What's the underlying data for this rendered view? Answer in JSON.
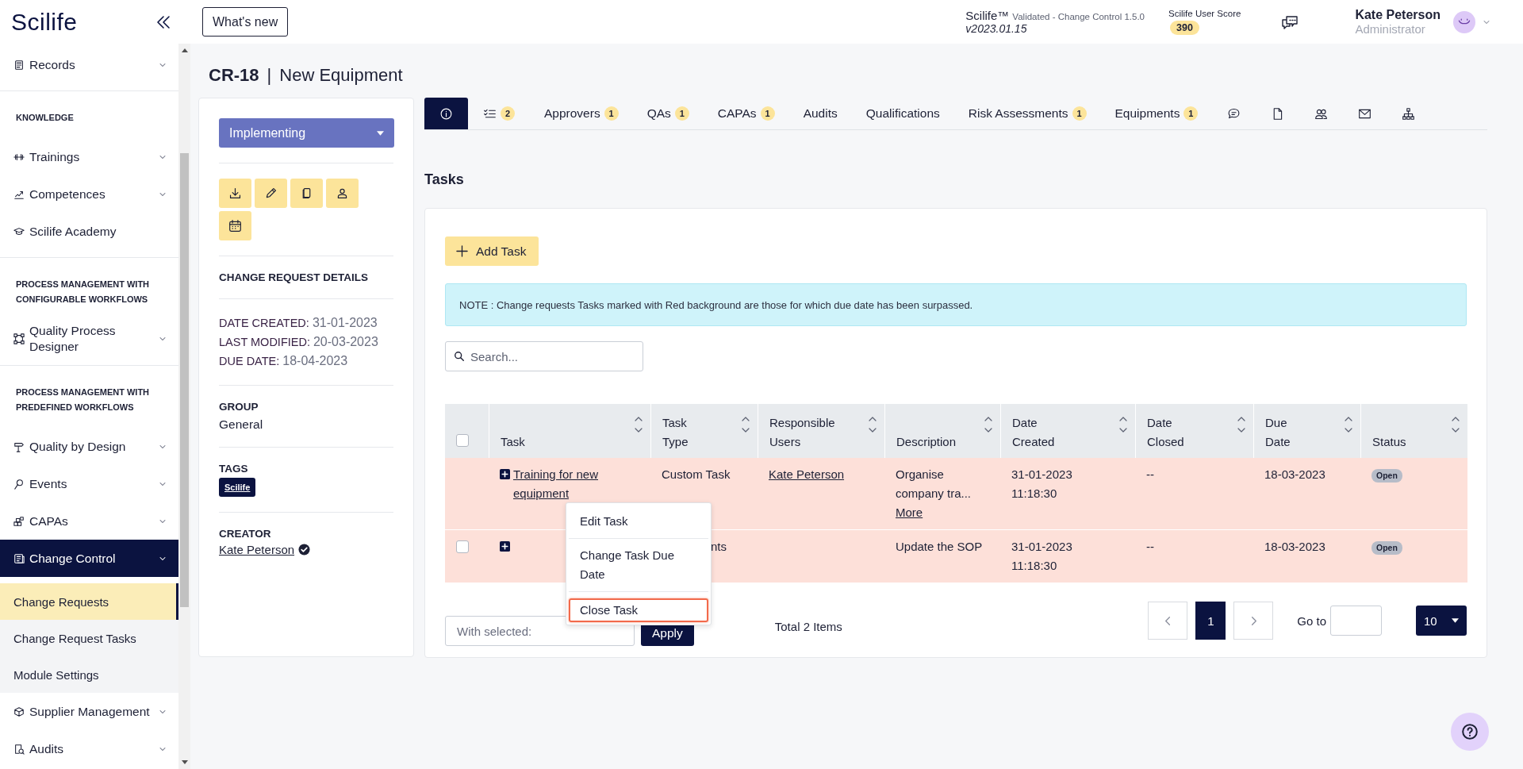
{
  "sidebar": {
    "logo": "Scilife",
    "items": [
      {
        "kind": "item",
        "label": "Records",
        "expandable": true,
        "selected": false
      },
      {
        "kind": "section",
        "label": "KNOWLEDGE"
      },
      {
        "kind": "item",
        "label": "Trainings",
        "expandable": true,
        "selected": false
      },
      {
        "kind": "item",
        "label": "Competences",
        "expandable": true,
        "selected": false
      },
      {
        "kind": "item",
        "label": "Scilife Academy",
        "expandable": false,
        "selected": false
      },
      {
        "kind": "section",
        "label": "PROCESS MANAGEMENT WITH CONFIGURABLE WORKFLOWS"
      },
      {
        "kind": "item",
        "label": "Quality Process Designer",
        "expandable": true,
        "selected": false
      },
      {
        "kind": "section",
        "label": "PROCESS MANAGEMENT WITH PREDEFINED WORKFLOWS"
      },
      {
        "kind": "item",
        "label": "Quality by Design",
        "expandable": true,
        "selected": false
      },
      {
        "kind": "item",
        "label": "Events",
        "expandable": true,
        "selected": false
      },
      {
        "kind": "item",
        "label": "CAPAs",
        "expandable": true,
        "selected": false
      },
      {
        "kind": "item",
        "label": "Change Control",
        "expandable": true,
        "selected": true,
        "children": [
          {
            "label": "Change Requests",
            "selected": true
          },
          {
            "label": "Change Request Tasks",
            "selected": false
          },
          {
            "label": "Module Settings",
            "selected": false
          }
        ]
      },
      {
        "kind": "item",
        "label": "Supplier Management",
        "expandable": true,
        "selected": false
      },
      {
        "kind": "item",
        "label": "Audits",
        "expandable": true,
        "selected": false
      }
    ]
  },
  "topbar": {
    "whats_new": "What's new",
    "product": "Scilife™",
    "edition": "Validated - Change Control 1.5.0",
    "version": "v2023.01.15",
    "score_label": "Scilife User Score",
    "score": "390",
    "user_name": "Kate Peterson",
    "user_role": "Administrator"
  },
  "page_title": {
    "code": "CR-18",
    "separator": "|",
    "name": "New Equipment"
  },
  "details": {
    "status": "Implementing",
    "section_title": "CHANGE REQUEST DETAILS",
    "fields": [
      {
        "label": "DATE CREATED:",
        "value": "31-01-2023"
      },
      {
        "label": "LAST MODIFIED:",
        "value": "20-03-2023"
      },
      {
        "label": "DUE DATE:",
        "value": "18-04-2023"
      }
    ],
    "group_label": "GROUP",
    "group": "General",
    "tags_label": "TAGS",
    "tags": [
      "Scilife"
    ],
    "creator_label": "CREATOR",
    "creator": "Kate Peterson",
    "creator_verified": true
  },
  "tabs": [
    {
      "kind": "icon",
      "selected": true
    },
    {
      "kind": "icon",
      "badge": "2",
      "selected": false
    },
    {
      "kind": "text",
      "label": "Approvers",
      "badge": "1",
      "selected": false
    },
    {
      "kind": "text",
      "label": "QAs",
      "badge": "1",
      "selected": false
    },
    {
      "kind": "text",
      "label": "CAPAs",
      "badge": "1",
      "selected": false
    },
    {
      "kind": "text",
      "label": "Audits",
      "selected": false
    },
    {
      "kind": "text",
      "label": "Qualifications",
      "selected": false
    },
    {
      "kind": "text",
      "label": "Risk Assessments",
      "badge": "1",
      "selected": false
    },
    {
      "kind": "text",
      "label": "Equipments",
      "badge": "1",
      "selected": false
    },
    {
      "kind": "icon",
      "selected": false
    },
    {
      "kind": "icon",
      "selected": false
    },
    {
      "kind": "icon",
      "selected": false
    },
    {
      "kind": "icon",
      "selected": false
    },
    {
      "kind": "icon",
      "selected": false
    }
  ],
  "tasks": {
    "title": "Tasks",
    "add_button": "Add Task",
    "note": "NOTE : Change requests Tasks marked with Red background are those for which due date has been surpassed.",
    "search_placeholder": "Search...",
    "header_checked": false,
    "columns": [
      "Task",
      "Task Type",
      "Responsible Users",
      "Description",
      "Date Created",
      "Date Closed",
      "Due Date",
      "Status"
    ],
    "rows": [
      {
        "overdue": true,
        "task": "Training for new equipment",
        "task_type": "Custom Task",
        "responsible": "Kate Peterson",
        "description": "Organise company tra...",
        "more": "More",
        "date_created": "31-01-2023 11:18:30",
        "date_closed": "--",
        "due_date": "18-03-2023",
        "status": "Open"
      },
      {
        "checked": false,
        "overdue": true,
        "task_type": "nts",
        "description": "Update the SOP",
        "date_created": "31-01-2023 11:18:30",
        "date_closed": "--",
        "due_date": "18-03-2023",
        "status": "Open"
      }
    ],
    "context_menu": [
      {
        "label": "Edit Task",
        "selected": false
      },
      {
        "label": "Change Task Due Date",
        "selected": false
      },
      {
        "label": "Close Task",
        "selected": true
      }
    ],
    "bulk_placeholder": "With selected:",
    "apply_button": "Apply",
    "total": "Total 2 Items",
    "pages": [
      {
        "label": "1",
        "selected": true
      }
    ],
    "goto_label": "Go to",
    "page_size": "10"
  }
}
